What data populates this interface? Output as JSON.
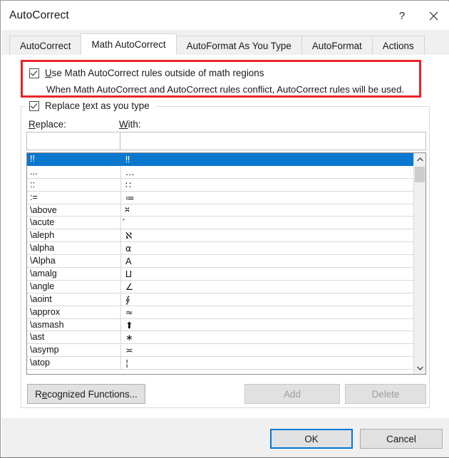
{
  "window": {
    "title": "AutoCorrect",
    "help_icon": "question-mark-icon",
    "close_icon": "close-icon"
  },
  "tabs": [
    {
      "label": "AutoCorrect",
      "active": false
    },
    {
      "label": "Math AutoCorrect",
      "active": true
    },
    {
      "label": "AutoFormat As You Type",
      "active": false
    },
    {
      "label": "AutoFormat",
      "active": false
    },
    {
      "label": "Actions",
      "active": false
    }
  ],
  "options": {
    "use_math_rules": {
      "label_prefix": "U",
      "label_rest": "se Math AutoCorrect rules outside of math regions",
      "checked": true
    },
    "hint": "When Math AutoCorrect and AutoCorrect rules conflict, AutoCorrect rules will be used.",
    "replace_as_you_type": {
      "label_a": "Replace ",
      "label_accel": "t",
      "label_b": "ext as you type",
      "checked": true
    }
  },
  "fields": {
    "replace_label_accel": "R",
    "replace_label_rest": "eplace:",
    "replace_value": "",
    "replace_placeholder": "",
    "with_label_accel": "W",
    "with_label_rest": "ith:",
    "with_value": "",
    "with_placeholder": ""
  },
  "list": {
    "selected_index": 0,
    "rows": [
      {
        "replace": "!!",
        "with": "‼"
      },
      {
        "replace": "...",
        "with": "…"
      },
      {
        "replace": "::",
        "with": "∷"
      },
      {
        "replace": ":=",
        "with": "≔"
      },
      {
        "replace": "\\above",
        "with": "⎶"
      },
      {
        "replace": "\\acute",
        "with": "́"
      },
      {
        "replace": "\\aleph",
        "with": "ℵ"
      },
      {
        "replace": "\\alpha",
        "with": "α"
      },
      {
        "replace": "\\Alpha",
        "with": "Α"
      },
      {
        "replace": "\\amalg",
        "with": "⨿"
      },
      {
        "replace": "\\angle",
        "with": "∠"
      },
      {
        "replace": "\\aoint",
        "with": "∮"
      },
      {
        "replace": "\\approx",
        "with": "≈"
      },
      {
        "replace": "\\asmash",
        "with": "⬆"
      },
      {
        "replace": "\\ast",
        "with": "∗"
      },
      {
        "replace": "\\asymp",
        "with": "≍"
      },
      {
        "replace": "\\atop",
        "with": "¦"
      }
    ],
    "scrollbar": {
      "up_arrow_icon": "chevron-up-icon",
      "down_arrow_icon": "chevron-down-icon"
    }
  },
  "buttons": {
    "recognized_functions": {
      "label_a": "R",
      "label_accel": "e",
      "label_b": "cognized Functions...",
      "enabled": true
    },
    "add": {
      "label": "Add",
      "enabled": false
    },
    "delete": {
      "label": "Delete",
      "enabled": false
    },
    "ok": {
      "label": "OK",
      "enabled": true,
      "default": true
    },
    "cancel": {
      "label": "Cancel",
      "enabled": true
    }
  },
  "colors": {
    "highlight_red": "#e8242a",
    "selection_blue": "#0b78d0",
    "focus_blue": "#0078d7",
    "dialog_chrome": "#f0f0f0"
  }
}
